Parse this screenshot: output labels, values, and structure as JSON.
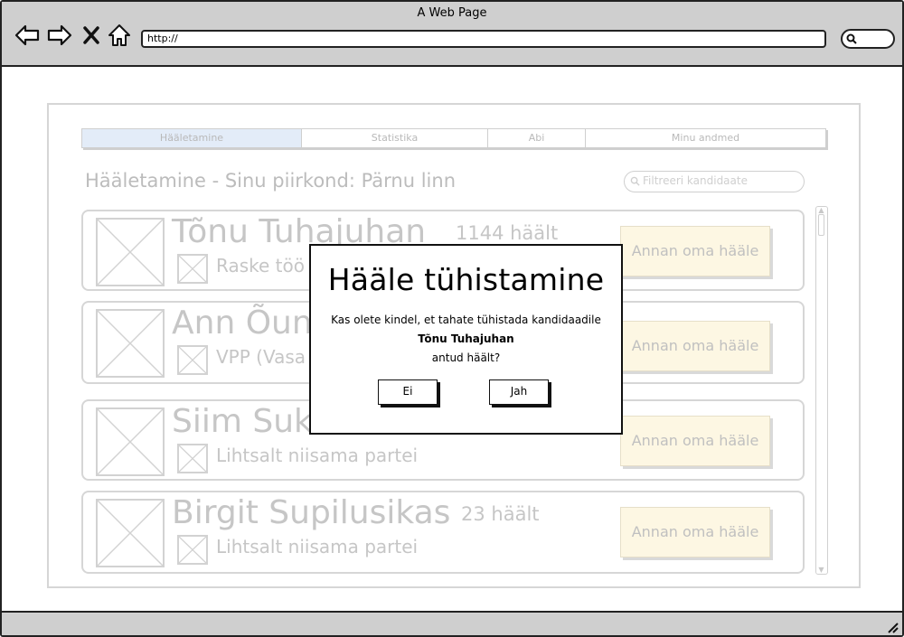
{
  "browser": {
    "window_title": "A Web Page",
    "url": "http://",
    "icons": [
      "back-arrow-icon",
      "forward-arrow-icon",
      "close-x-icon",
      "home-icon",
      "search-icon"
    ]
  },
  "page": {
    "tabs": [
      "Hääletamine",
      "Statistika",
      "Abi",
      "Minu andmed"
    ],
    "heading": "Hääletamine - Sinu piirkond: Pärnu linn",
    "filter_placeholder": "Filtreeri kandidaate",
    "candidates": [
      {
        "name": "Tõnu Tuhajuhan",
        "votes": "1144 häält",
        "party": "Raske töö",
        "button": "Annan oma hääle"
      },
      {
        "name": "Ann Õun",
        "votes": "",
        "party": "VPP (Vasa",
        "button": "Annan oma hääle"
      },
      {
        "name": "Siim Suk",
        "votes": "",
        "party": "Lihtsalt niisama partei",
        "button": "Annan oma hääle"
      },
      {
        "name": "Birgit Supilusikas",
        "votes": "23 häält",
        "party": "Lihtsalt niisama partei",
        "button": "Annan oma hääle"
      }
    ]
  },
  "dialog": {
    "title": "Hääle tühistamine",
    "line1": "Kas olete kindel, et tahate tühistada kandidaadile",
    "candidate": "Tõnu Tuhajuhan",
    "line3": "antud häält?",
    "no_button": "Ei",
    "yes_button": "Jah"
  },
  "colors": {
    "chrome": "#cfcfcf",
    "active_tab": "#e3ecf8",
    "vote_button": "#fdf7e3",
    "dimmed_text": "#c6c6c6"
  }
}
